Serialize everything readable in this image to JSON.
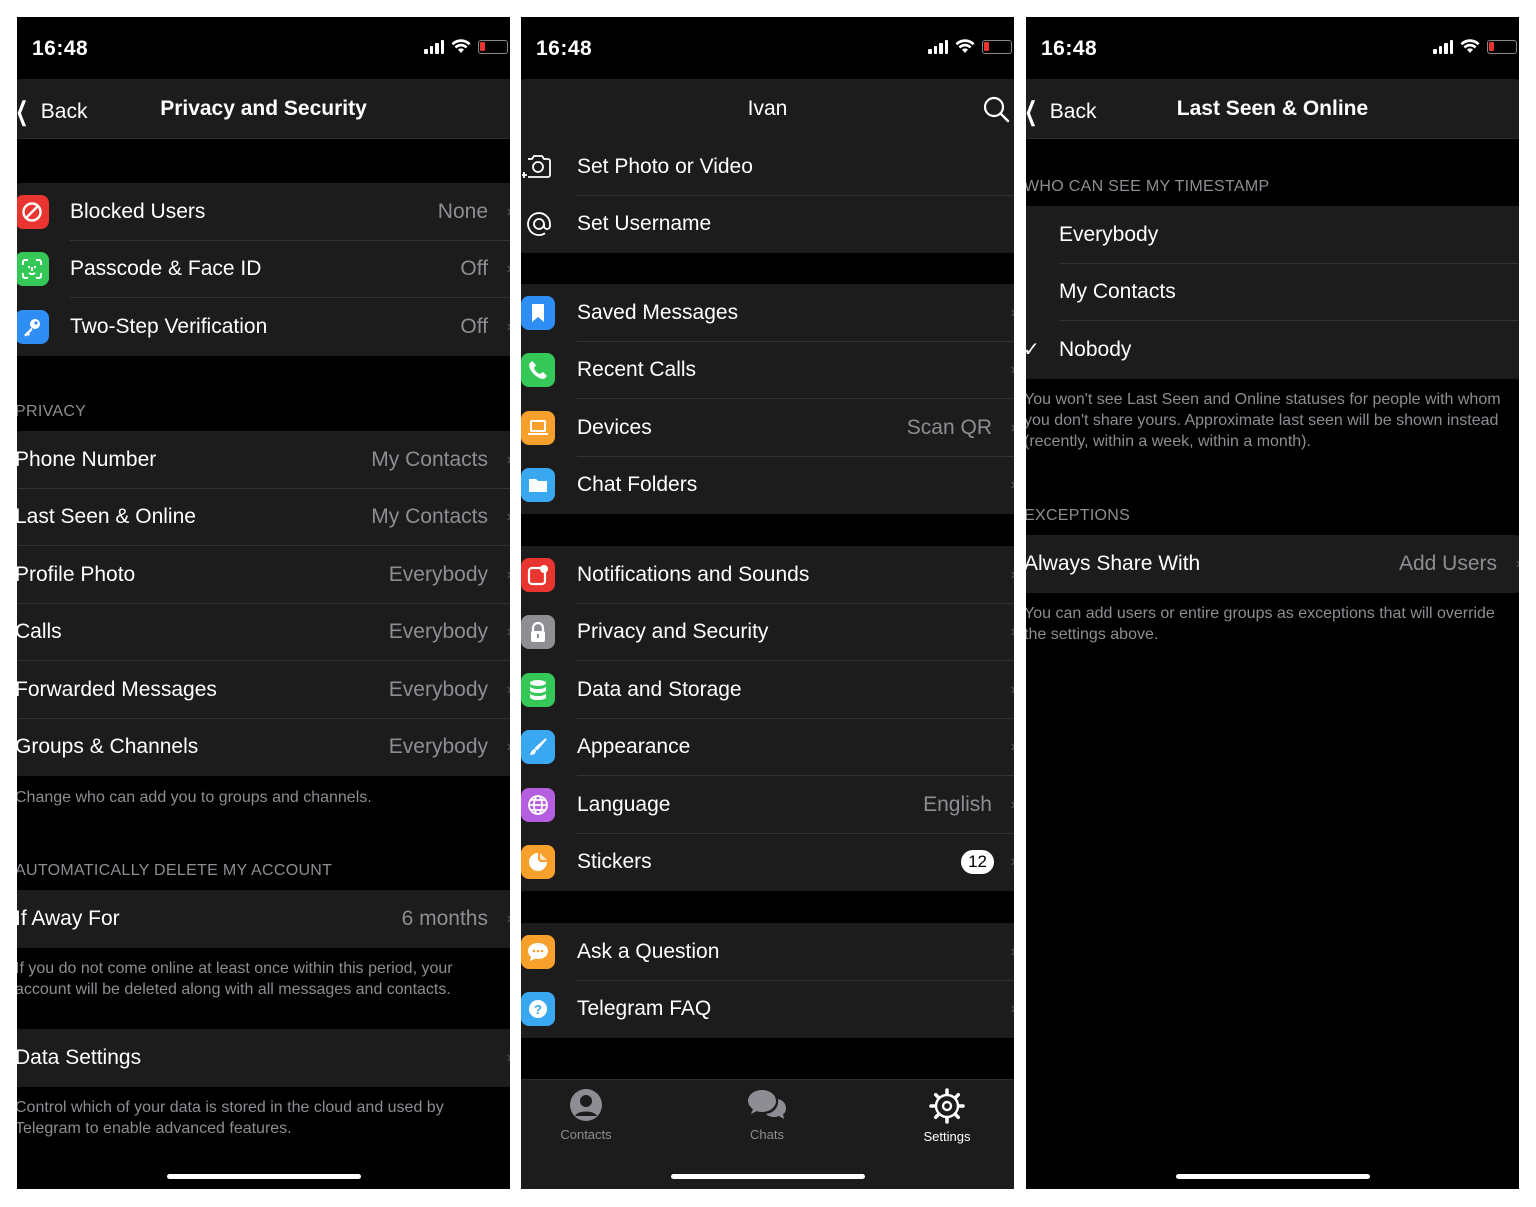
{
  "status_time": "16:48",
  "screen1": {
    "back": "Back",
    "title": "Privacy and Security",
    "security": [
      {
        "label": "Blocked Users",
        "value": "None",
        "icon": "blocked-icon",
        "color": "#e9352f"
      },
      {
        "label": "Passcode & Face ID",
        "value": "Off",
        "icon": "face-id-icon",
        "color": "#36c759"
      },
      {
        "label": "Two-Step Verification",
        "value": "Off",
        "icon": "key-icon",
        "color": "#2f8ef3"
      }
    ],
    "privacy_header": "PRIVACY",
    "privacy": [
      {
        "label": "Phone Number",
        "value": "My Contacts"
      },
      {
        "label": "Last Seen & Online",
        "value": "My Contacts"
      },
      {
        "label": "Profile Photo",
        "value": "Everybody"
      },
      {
        "label": "Calls",
        "value": "Everybody"
      },
      {
        "label": "Forwarded Messages",
        "value": "Everybody"
      },
      {
        "label": "Groups & Channels",
        "value": "Everybody"
      }
    ],
    "privacy_footer": "Change who can add you to groups and channels.",
    "delete_header": "AUTOMATICALLY DELETE MY ACCOUNT",
    "away_label": "If Away For",
    "away_value": "6 months",
    "away_footer": "If you do not come online at least once within this period, your account will be deleted along with all messages and contacts.",
    "data_settings": "Data Settings",
    "data_footer": "Control which of your data is stored in the cloud and used by Telegram to enable advanced features."
  },
  "screen2": {
    "title": "Ivan",
    "profile": [
      {
        "label": "Set Photo or Video",
        "icon": "camera-add-icon"
      },
      {
        "label": "Set Username",
        "icon": "at-icon"
      }
    ],
    "group1": [
      {
        "label": "Saved Messages",
        "value": "",
        "icon": "bookmark-icon",
        "color": "#2f8ef3"
      },
      {
        "label": "Recent Calls",
        "value": "",
        "icon": "phone-icon",
        "color": "#36c759"
      },
      {
        "label": "Devices",
        "value": "Scan QR",
        "icon": "laptop-icon",
        "color": "#f7a02c"
      },
      {
        "label": "Chat Folders",
        "value": "",
        "icon": "folder-icon",
        "color": "#3aa8f0"
      }
    ],
    "group2": [
      {
        "label": "Notifications and Sounds",
        "value": "",
        "icon": "notification-icon",
        "color": "#e9352f"
      },
      {
        "label": "Privacy and Security",
        "value": "",
        "icon": "lock-icon",
        "color": "#8e8e93"
      },
      {
        "label": "Data and Storage",
        "value": "",
        "icon": "database-icon",
        "color": "#36c759"
      },
      {
        "label": "Appearance",
        "value": "",
        "icon": "brush-icon",
        "color": "#3aa8f0"
      },
      {
        "label": "Language",
        "value": "English",
        "icon": "globe-icon",
        "color": "#b55fe0"
      },
      {
        "label": "Stickers",
        "value": "",
        "badge": "12",
        "icon": "sticker-icon",
        "color": "#f7a02c"
      }
    ],
    "group3": [
      {
        "label": "Ask a Question",
        "icon": "chat-bubble-icon",
        "color": "#f7a02c"
      },
      {
        "label": "Telegram FAQ",
        "icon": "question-icon",
        "color": "#3aa8f0"
      }
    ],
    "tabs": [
      {
        "label": "Contacts",
        "icon": "person-icon"
      },
      {
        "label": "Chats",
        "icon": "chats-icon"
      },
      {
        "label": "Settings",
        "icon": "gear-icon"
      }
    ]
  },
  "screen3": {
    "back": "Back",
    "title": "Last Seen & Online",
    "header": "WHO CAN SEE MY TIMESTAMP",
    "options": [
      "Everybody",
      "My Contacts",
      "Nobody"
    ],
    "selected": "Nobody",
    "footer": "You won't see Last Seen and Online statuses for people with whom you don't share yours. Approximate last seen will be shown instead (recently, within a week, within a month).",
    "exceptions_header": "EXCEPTIONS",
    "always_label": "Always Share With",
    "always_value": "Add Users",
    "exceptions_footer": "You can add users or entire groups as exceptions that will override the settings above."
  }
}
